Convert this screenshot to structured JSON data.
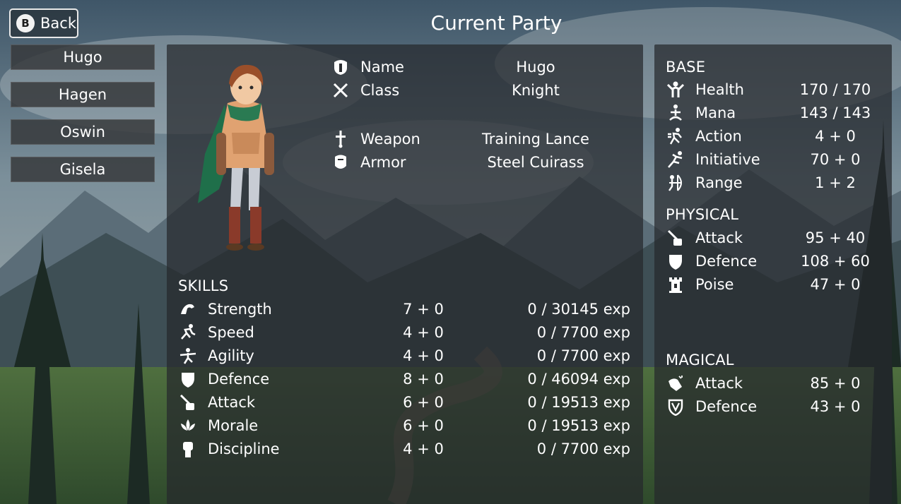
{
  "header": {
    "back_key": "B",
    "back_label": "Back",
    "title": "Current Party"
  },
  "party": [
    "Hugo",
    "Hagen",
    "Oswin",
    "Gisela"
  ],
  "character": {
    "name_label": "Name",
    "name": "Hugo",
    "class_label": "Class",
    "class": "Knight",
    "weapon_label": "Weapon",
    "weapon": "Training Lance",
    "armor_label": "Armor",
    "armor": "Steel Cuirass"
  },
  "skills": {
    "heading": "SKILLS",
    "items": [
      {
        "name": "Strength",
        "value": "7 + 0",
        "exp": "0 / 30145 exp",
        "icon": "flexed-arm-icon"
      },
      {
        "name": "Speed",
        "value": "4 + 0",
        "exp": "0 / 7700 exp",
        "icon": "running-figure-icon"
      },
      {
        "name": "Agility",
        "value": "4 + 0",
        "exp": "0 / 7700 exp",
        "icon": "acrobat-figure-icon"
      },
      {
        "name": "Defence",
        "value": "8 + 0",
        "exp": "0 / 46094 exp",
        "icon": "shield-icon"
      },
      {
        "name": "Attack",
        "value": "6 + 0",
        "exp": "0 / 19513 exp",
        "icon": "sword-hand-icon"
      },
      {
        "name": "Morale",
        "value": "6 + 0",
        "exp": "0 / 19513 exp",
        "icon": "lotus-icon"
      },
      {
        "name": "Discipline",
        "value": "4 + 0",
        "exp": "0 / 7700 exp",
        "icon": "raised-fist-icon"
      }
    ]
  },
  "base": {
    "heading": "BASE",
    "items": [
      {
        "name": "Health",
        "value": "170 / 170",
        "icon": "strongman-icon"
      },
      {
        "name": "Mana",
        "value": "143 / 143",
        "icon": "meditating-figure-icon"
      },
      {
        "name": "Action",
        "value": "4 + 0",
        "icon": "dashing-figure-icon"
      },
      {
        "name": "Initiative",
        "value": "70 + 0",
        "icon": "leaping-figure-icon"
      },
      {
        "name": "Range",
        "value": "1 + 2",
        "icon": "archer-icon"
      }
    ]
  },
  "physical": {
    "heading": "PHYSICAL",
    "items": [
      {
        "name": "Attack",
        "value": "95 + 40",
        "icon": "sword-hand-icon"
      },
      {
        "name": "Defence",
        "value": "108 + 60",
        "icon": "shield-icon"
      },
      {
        "name": "Poise",
        "value": "47 + 0",
        "icon": "tower-icon"
      }
    ]
  },
  "magical": {
    "heading": "MAGICAL",
    "items": [
      {
        "name": "Attack",
        "value": "85 + 0",
        "icon": "magic-hand-icon"
      },
      {
        "name": "Defence",
        "value": "43 + 0",
        "icon": "magic-shield-icon"
      }
    ]
  }
}
